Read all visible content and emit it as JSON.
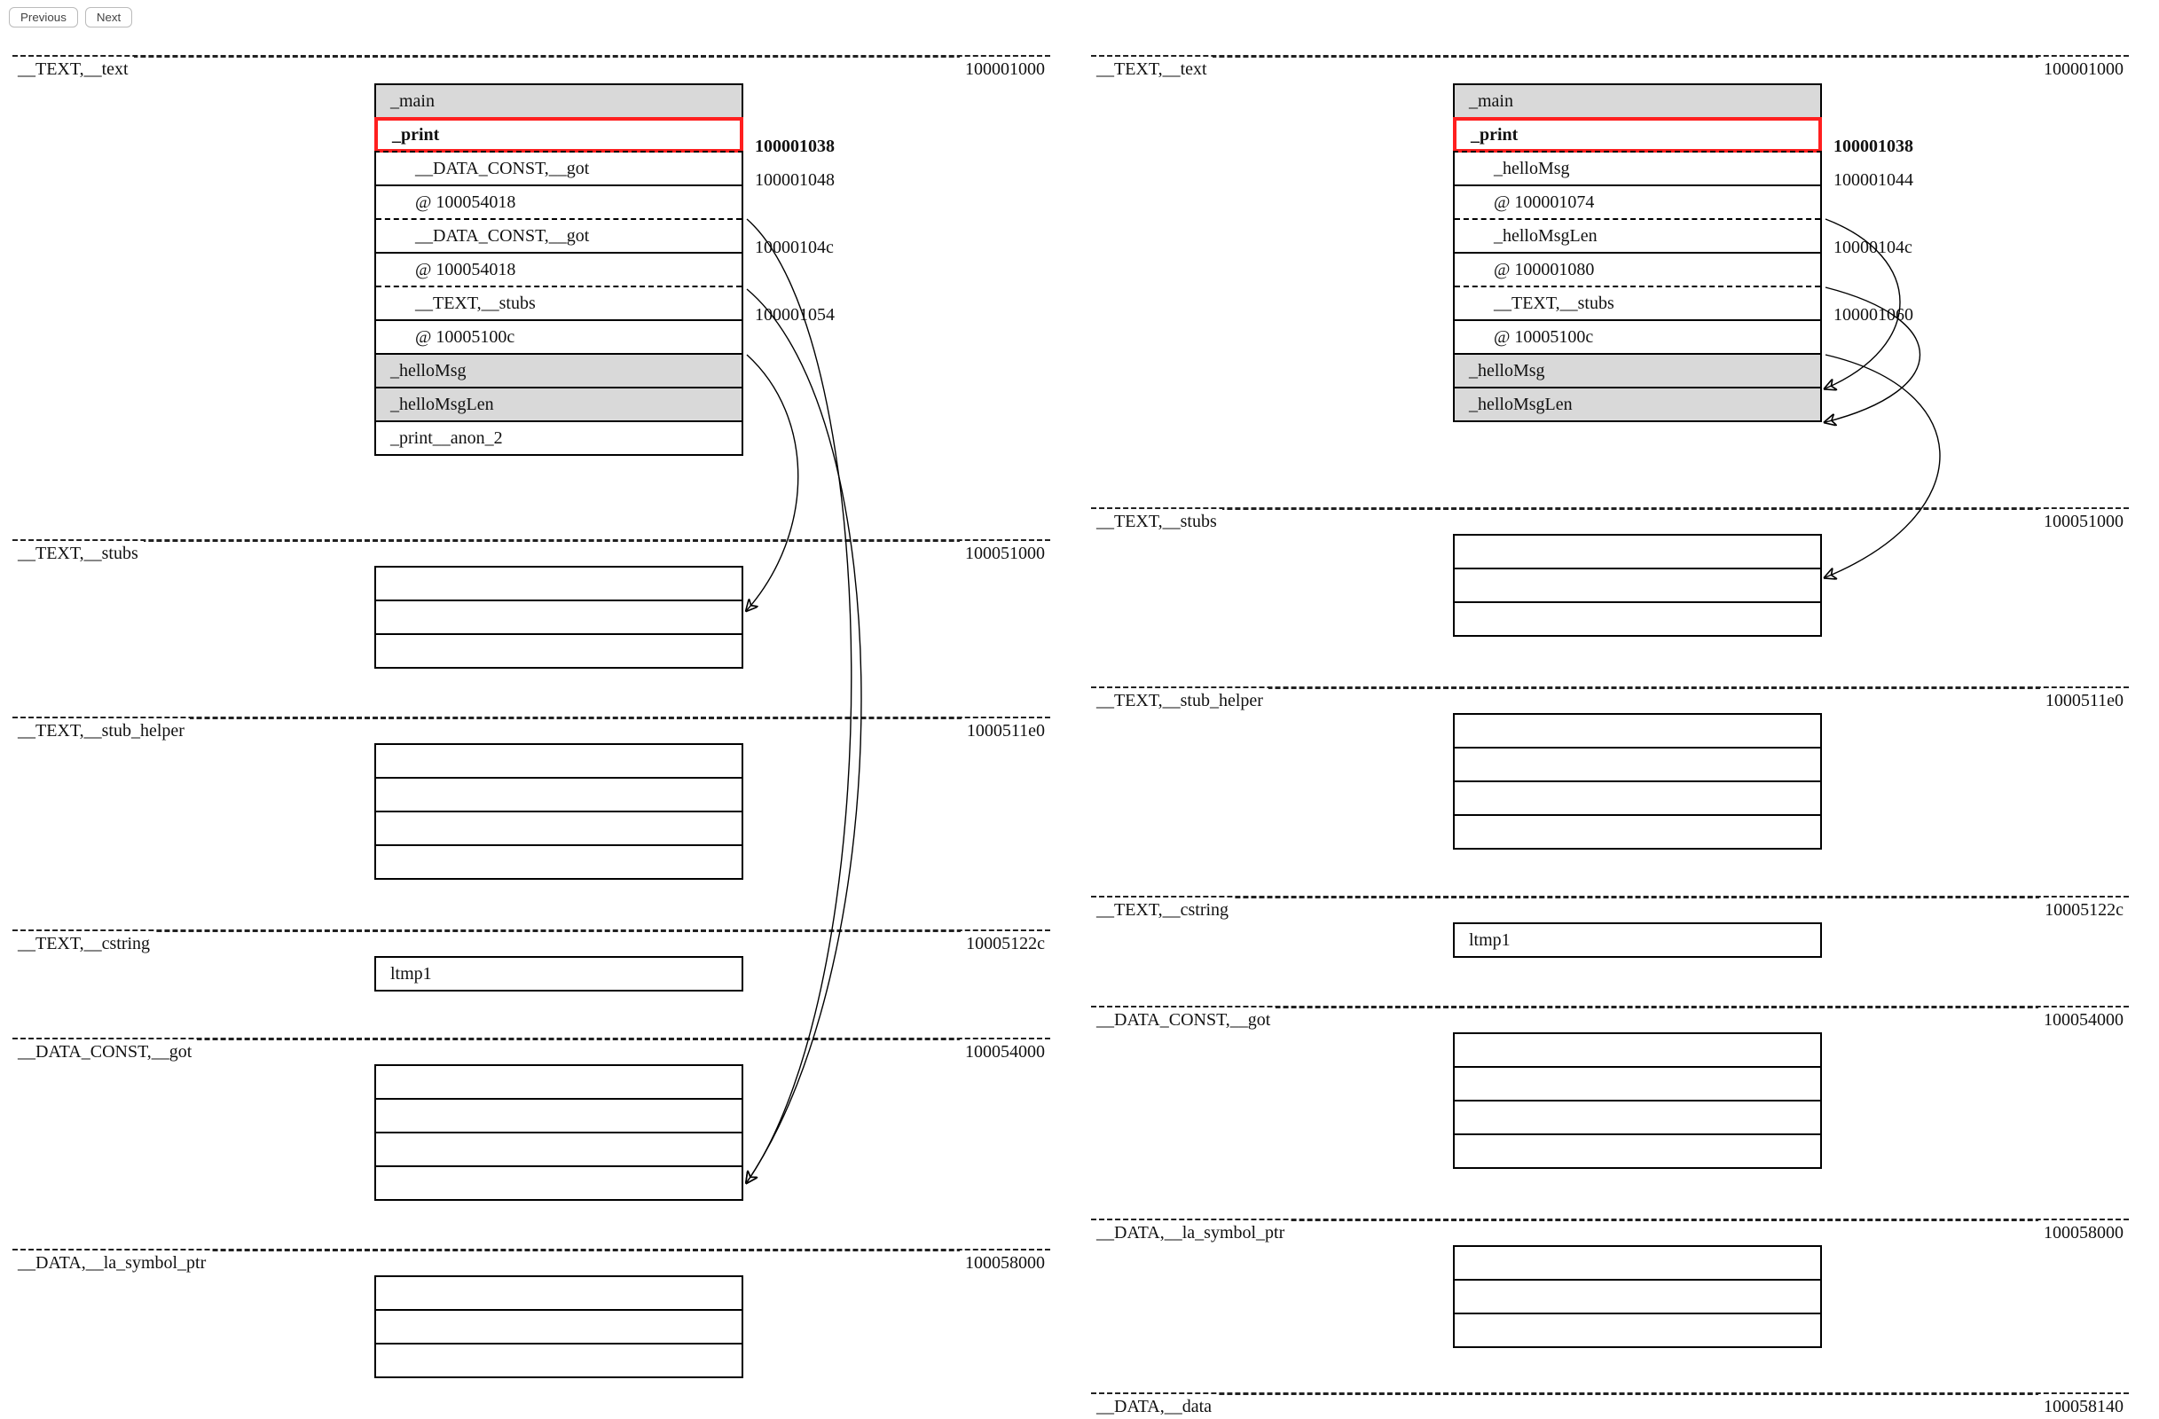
{
  "toolbar": {
    "previous_label": "Previous",
    "next_label": "Next"
  },
  "left": {
    "sections": {
      "text": {
        "label": "__TEXT,__text",
        "addr": "100001000"
      },
      "stubs": {
        "label": "__TEXT,__stubs",
        "addr": "100051000"
      },
      "stub_helper": {
        "label": "__TEXT,__stub_helper",
        "addr": "1000511e0"
      },
      "cstring": {
        "label": "__TEXT,__cstring",
        "addr": "10005122c"
      },
      "got": {
        "label": "__DATA_CONST,__got",
        "addr": "100054000"
      },
      "la_symbol_ptr": {
        "label": "__DATA,__la_symbol_ptr",
        "addr": "100058000"
      }
    },
    "cells": {
      "main": "_main",
      "print": "_print",
      "got_line1": "__DATA_CONST,__got",
      "got_at_1": "@ 100054018",
      "got_line2": "__DATA_CONST,__got",
      "got_at_2": "@ 100054018",
      "stubs_line1": "__TEXT,__stubs",
      "stubs_at": "@ 10005100c",
      "helloMsg": "_helloMsg",
      "helloMsgLen": "_helloMsgLen",
      "print_anon2": "_print__anon_2",
      "ltmp1": "ltmp1"
    },
    "addrs": {
      "print": "100001038",
      "a1": "100001048",
      "a2": "10000104c",
      "a3": "100001054"
    }
  },
  "right": {
    "sections": {
      "text": {
        "label": "__TEXT,__text",
        "addr": "100001000"
      },
      "stubs": {
        "label": "__TEXT,__stubs",
        "addr": "100051000"
      },
      "stub_helper": {
        "label": "__TEXT,__stub_helper",
        "addr": "1000511e0"
      },
      "cstring": {
        "label": "__TEXT,__cstring",
        "addr": "10005122c"
      },
      "got": {
        "label": "__DATA_CONST,__got",
        "addr": "100054000"
      },
      "la_symbol_ptr": {
        "label": "__DATA,__la_symbol_ptr",
        "addr": "100058000"
      },
      "data": {
        "label": "__DATA,__data",
        "addr": "100058140"
      }
    },
    "cells": {
      "main": "_main",
      "print": "_print",
      "helloMsg_ref": "_helloMsg",
      "helloMsg_at": "@ 100001074",
      "helloMsgLen_ref": "_helloMsgLen",
      "helloMsgLen_at": "@ 100001080",
      "stubs_line1": "__TEXT,__stubs",
      "stubs_at": "@ 10005100c",
      "helloMsg": "_helloMsg",
      "helloMsgLen": "_helloMsgLen",
      "ltmp1": "ltmp1"
    },
    "addrs": {
      "print": "100001038",
      "a1": "100001044",
      "a2": "10000104c",
      "a3": "100001060"
    }
  }
}
